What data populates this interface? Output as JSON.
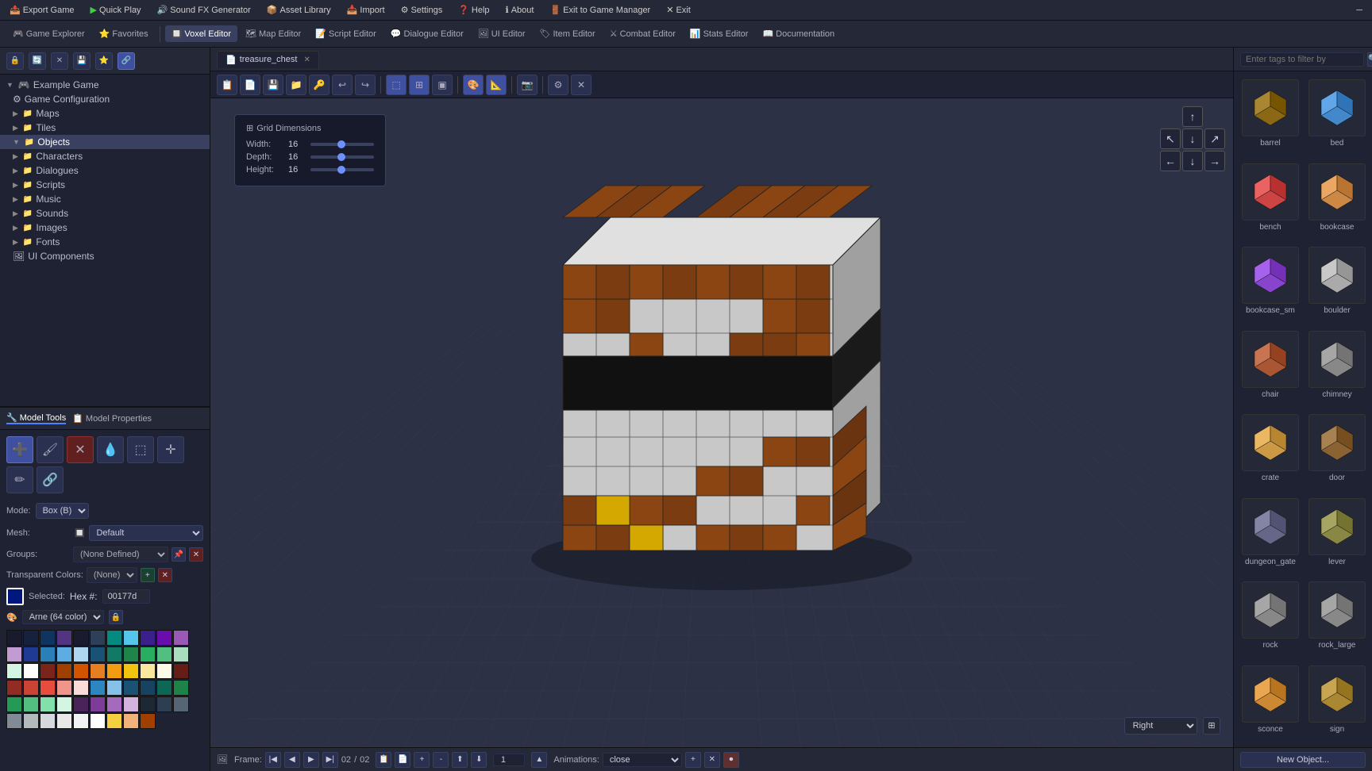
{
  "topMenu": {
    "items": [
      {
        "id": "export-game",
        "label": "Export Game",
        "icon": "📤"
      },
      {
        "id": "quick-play",
        "label": "Quick Play",
        "icon": "▶"
      },
      {
        "id": "sound-fx",
        "label": "Sound FX Generator",
        "icon": "🔊"
      },
      {
        "id": "asset-library",
        "label": "Asset Library",
        "icon": "📦"
      },
      {
        "id": "import",
        "label": "Import",
        "icon": "📥"
      },
      {
        "id": "settings",
        "label": "Settings",
        "icon": "⚙"
      },
      {
        "id": "help",
        "label": "Help",
        "icon": "❓"
      },
      {
        "id": "about",
        "label": "About",
        "icon": "ℹ"
      },
      {
        "id": "exit-manager",
        "label": "Exit to Game Manager",
        "icon": "🚪"
      },
      {
        "id": "exit",
        "label": "Exit",
        "icon": "✕"
      }
    ]
  },
  "toolbar": {
    "tabs": [
      {
        "id": "game-explorer",
        "label": "Game Explorer",
        "icon": "🎮"
      },
      {
        "id": "favorites",
        "label": "Favorites",
        "icon": "⭐"
      },
      {
        "id": "voxel-editor",
        "label": "Voxel Editor",
        "icon": "🔲",
        "active": true
      },
      {
        "id": "map-editor",
        "label": "Map Editor",
        "icon": "🗺"
      },
      {
        "id": "script-editor",
        "label": "Script Editor",
        "icon": "📝"
      },
      {
        "id": "dialogue-editor",
        "label": "Dialogue Editor",
        "icon": "💬"
      },
      {
        "id": "ui-editor",
        "label": "UI Editor",
        "icon": "🖼"
      },
      {
        "id": "item-editor",
        "label": "Item Editor",
        "icon": "🏷"
      },
      {
        "id": "combat-editor",
        "label": "Combat Editor",
        "icon": "⚔"
      },
      {
        "id": "stats-editor",
        "label": "Stats Editor",
        "icon": "📊"
      },
      {
        "id": "documentation",
        "label": "Documentation",
        "icon": "📖"
      }
    ]
  },
  "leftPanel": {
    "tabs": [
      {
        "id": "model-tools",
        "label": "Model Tools",
        "icon": "🔧",
        "active": true
      },
      {
        "id": "model-properties",
        "label": "Model Properties",
        "icon": "📋"
      }
    ],
    "fileTree": {
      "root": "Example Game",
      "items": [
        {
          "id": "game-config",
          "label": "Game Configuration",
          "indent": 1,
          "icon": "⚙"
        },
        {
          "id": "maps",
          "label": "Maps",
          "indent": 1,
          "icon": "📁",
          "type": "folder"
        },
        {
          "id": "tiles",
          "label": "Tiles",
          "indent": 1,
          "icon": "📁",
          "type": "folder"
        },
        {
          "id": "objects",
          "label": "Objects",
          "indent": 1,
          "icon": "📁",
          "type": "folder",
          "selected": true
        },
        {
          "id": "characters",
          "label": "Characters",
          "indent": 1,
          "icon": "📁",
          "type": "folder"
        },
        {
          "id": "dialogues",
          "label": "Dialogues",
          "indent": 1,
          "icon": "📁",
          "type": "folder"
        },
        {
          "id": "scripts",
          "label": "Scripts",
          "indent": 1,
          "icon": "📁",
          "type": "folder"
        },
        {
          "id": "music",
          "label": "Music",
          "indent": 1,
          "icon": "📁",
          "type": "folder"
        },
        {
          "id": "sounds",
          "label": "Sounds",
          "indent": 1,
          "icon": "📁",
          "type": "folder"
        },
        {
          "id": "images",
          "label": "Images",
          "indent": 1,
          "icon": "📁",
          "type": "folder"
        },
        {
          "id": "fonts",
          "label": "Fonts",
          "indent": 1,
          "icon": "📁",
          "type": "folder"
        },
        {
          "id": "ui-components",
          "label": "UI Components",
          "indent": 1,
          "icon": "🖼"
        }
      ]
    }
  },
  "modelTools": {
    "mode": "Box (B)",
    "mesh": "Default",
    "groups": "(None Defined)",
    "transparentColors": "(None)",
    "selectedColor": "#00177d",
    "hexValue": "00177d",
    "paletteLabel": "Arne (64 color)"
  },
  "viewport": {
    "activeTab": "treasure_chest",
    "gridDimensions": {
      "title": "Grid Dimensions",
      "width": {
        "label": "Width:",
        "value": 16
      },
      "depth": {
        "label": "Depth:",
        "value": 16
      },
      "height": {
        "label": "Height:",
        "value": 16
      }
    },
    "viewMode": "Right",
    "frame": {
      "current": "02",
      "total": "02"
    },
    "frameStep": "1",
    "animation": {
      "label": "Animations:",
      "value": "close"
    }
  },
  "rightPanel": {
    "searchPlaceholder": "Enter tags to filter by",
    "assets": [
      {
        "id": "barrel",
        "label": "barrel"
      },
      {
        "id": "bed",
        "label": "bed"
      },
      {
        "id": "bench",
        "label": "bench"
      },
      {
        "id": "bookcase",
        "label": "bookcase"
      },
      {
        "id": "bookcase_sm",
        "label": "bookcase_sm"
      },
      {
        "id": "boulder",
        "label": "boulder"
      },
      {
        "id": "chair",
        "label": "chair"
      },
      {
        "id": "chimney",
        "label": "chimney"
      },
      {
        "id": "crate",
        "label": "crate"
      },
      {
        "id": "door",
        "label": "door"
      },
      {
        "id": "dungeon_gate",
        "label": "dungeon_gate"
      },
      {
        "id": "lever",
        "label": "lever"
      },
      {
        "id": "rock",
        "label": "rock"
      },
      {
        "id": "rock_large",
        "label": "rock_large"
      },
      {
        "id": "sconce",
        "label": "sconce"
      },
      {
        "id": "sign",
        "label": "sign"
      }
    ],
    "newObjectButton": "New Object..."
  },
  "colors": {
    "palette": [
      "#1a1a2e",
      "#16213e",
      "#0f3460",
      "#533483",
      "#1b1b2f",
      "#2e4057",
      "#048a81",
      "#54c6eb",
      "#3b1f8c",
      "#6a0dad",
      "#9b59b6",
      "#c39bd3",
      "#1f3a93",
      "#2980b9",
      "#5dade2",
      "#aed6f1",
      "#1a5276",
      "#117a65",
      "#1e8449",
      "#27ae60",
      "#52be80",
      "#a9dfbf",
      "#d5f5e3",
      "#fdfefe",
      "#7b241c",
      "#a04000",
      "#d35400",
      "#e67e22",
      "#f39c12",
      "#f1c40f",
      "#f9e79f",
      "#fef9e7",
      "#641e16",
      "#922b21",
      "#cb4335",
      "#e74c3c",
      "#f1948a",
      "#fadbd8",
      "#2e86c1",
      "#85c1e9",
      "#1a5276",
      "#154360",
      "#0e6655",
      "#1d8348",
      "#239b56",
      "#52be80",
      "#82e0aa",
      "#d5f5e3",
      "#4a235a",
      "#7d3c98",
      "#a569bd",
      "#d2b4de",
      "#1c2833",
      "#2c3e50",
      "#566573",
      "#808b96",
      "#b2babb",
      "#d5d8dc",
      "#e8e8e8",
      "#f2f3f4",
      "#ffffff",
      "#f4d03f",
      "#f0b27a",
      "#a04000"
    ]
  }
}
